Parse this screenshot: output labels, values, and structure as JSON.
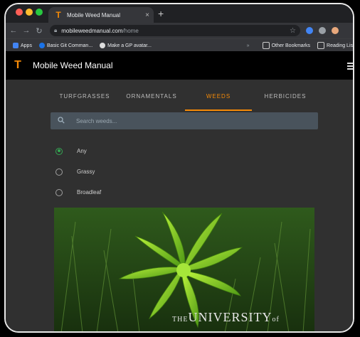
{
  "browser": {
    "tab_title": "Mobile Weed Manual",
    "tab_close": "×",
    "new_tab": "+",
    "url_domain": "mobileweedmanual.com",
    "url_path": "/home",
    "bookmarks": [
      "Apps",
      "Basic Git Comman...",
      "Make a GP avatar..."
    ],
    "bookmarks_right": [
      "Other Bookmarks",
      "Reading Lis"
    ],
    "colors": {
      "close": "#ff5f57",
      "min": "#febc2e",
      "max": "#28c840"
    }
  },
  "site": {
    "logo": "T",
    "title": "Mobile Weed Manual",
    "brand_color": "#f58a07"
  },
  "tabs": [
    {
      "label": "TURFGRASSES"
    },
    {
      "label": "ORNAMENTALS"
    },
    {
      "label": "WEEDS",
      "active": true
    },
    {
      "label": "HERBICIDES"
    }
  ],
  "search": {
    "placeholder": "Search weeds..."
  },
  "filters": [
    {
      "label": "Any",
      "selected": true
    },
    {
      "label": "Grassy",
      "selected": false
    },
    {
      "label": "Broadleaf",
      "selected": false
    }
  ],
  "hero": {
    "caption_small": "THE",
    "caption": "UNIVERSITY",
    "caption_end": "of"
  }
}
